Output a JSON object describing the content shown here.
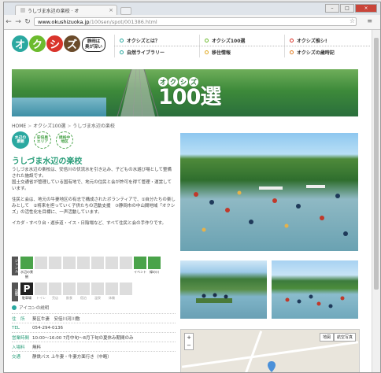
{
  "browser": {
    "tab_title": "うしづま水辺の楽校 · オ",
    "tab_close": "×",
    "url_domain": "www.okushizuoka.jp",
    "url_path": "/100sen/spot/001386.html",
    "win_min": "–",
    "win_max": "□",
    "win_close": "×"
  },
  "header": {
    "logo_chars": [
      "オ",
      "ク",
      "シ",
      "ズ"
    ],
    "logo_colors": [
      "#2aa8a0",
      "#6cbb2e",
      "#d9342b",
      "#6b4b2b"
    ],
    "bubble_line1": "静岡は",
    "bubble_line2": "奥が深い",
    "nav_row1": [
      {
        "label": "オクシズとは？",
        "color": "#2aa8a0"
      },
      {
        "label": "オクシズ100選",
        "color": "#6cbb2e"
      },
      {
        "label": "オクシズ推シ!",
        "color": "#d9342b"
      }
    ],
    "nav_row2": [
      {
        "label": "自然ライブラリー",
        "color": "#2aa8a0"
      },
      {
        "label": "移住情報",
        "color": "#e0a81f"
      },
      {
        "label": "オクシズの歳時記",
        "color": "#e07b1f"
      }
    ]
  },
  "banner": {
    "chars": [
      "オ",
      "ク",
      "シ",
      "ズ"
    ],
    "big": "100選"
  },
  "breadcrumb": [
    "HOME",
    "オクシズ100選",
    "うしづま水辺の楽校"
  ],
  "badges": [
    {
      "text": "水辺の\n景観"
    },
    {
      "text": "安倍奥\nエリア"
    },
    {
      "text": "規格中\n地区"
    }
  ],
  "spot": {
    "title": "うしづま水辺の楽校",
    "desc1": "うしづま水辺の楽校は、安倍川の伏流水を引き込み、子どもの水遊び場として整備された施設です。",
    "desc2": "国土交通省が管理している国有地で、地元の住民と会が許可を得て管理・運営しています。",
    "desc3": "住民と会は、地元の牛妻地区の有志で構成されたボランティアで、①自分たちの楽しみとして　②将来を担っていく子供たちの活動支援　③静岡市の中山間地域「オクシズ」の活性化を目標に、一声活動しています。",
    "desc4": "イカダ・すべり台・遊歩道・イス・日陰場など、すべて住民と会の手作りです。"
  },
  "icons": {
    "genre_label": "ジャンル",
    "genre": [
      {
        "label": "水辺の景観",
        "on": true
      },
      {
        "label": "",
        "on": false
      },
      {
        "label": "",
        "on": false
      },
      {
        "label": "",
        "on": false
      },
      {
        "label": "",
        "on": false
      },
      {
        "label": "",
        "on": false
      },
      {
        "label": "",
        "on": false
      },
      {
        "label": "",
        "on": false
      },
      {
        "label": "イベント",
        "on": true
      },
      {
        "label": "緑の川",
        "on": true
      }
    ],
    "facility_label": "設備",
    "facility": [
      {
        "label": "駐車場",
        "on": true
      },
      {
        "label": "トイレ",
        "on": false
      },
      {
        "label": "売店",
        "on": false
      },
      {
        "label": "飲食",
        "on": false
      },
      {
        "label": "宿泊",
        "on": false
      },
      {
        "label": "温泉",
        "on": false
      },
      {
        "label": "体験",
        "on": false
      },
      {
        "label": "",
        "on": false
      }
    ],
    "explain_link": "アイコンの説明"
  },
  "info": [
    {
      "k": "住　所",
      "v": "葵区牛妻　安倍川河川敷"
    },
    {
      "k": "TEL",
      "v": "054-294-0136"
    },
    {
      "k": "営業時間",
      "v": "10:00〜16:00 7月中旬〜8月下旬の夏休み期間のみ"
    },
    {
      "k": "入場料",
      "v": "無料"
    },
    {
      "k": "交通",
      "v": "静鉄バス 上牛妻・牛妻方面行き（中略）"
    }
  ],
  "map": {
    "map_btn": "地図",
    "sat_btn": "航空写真",
    "zoom_in": "+",
    "zoom_out": "−"
  }
}
